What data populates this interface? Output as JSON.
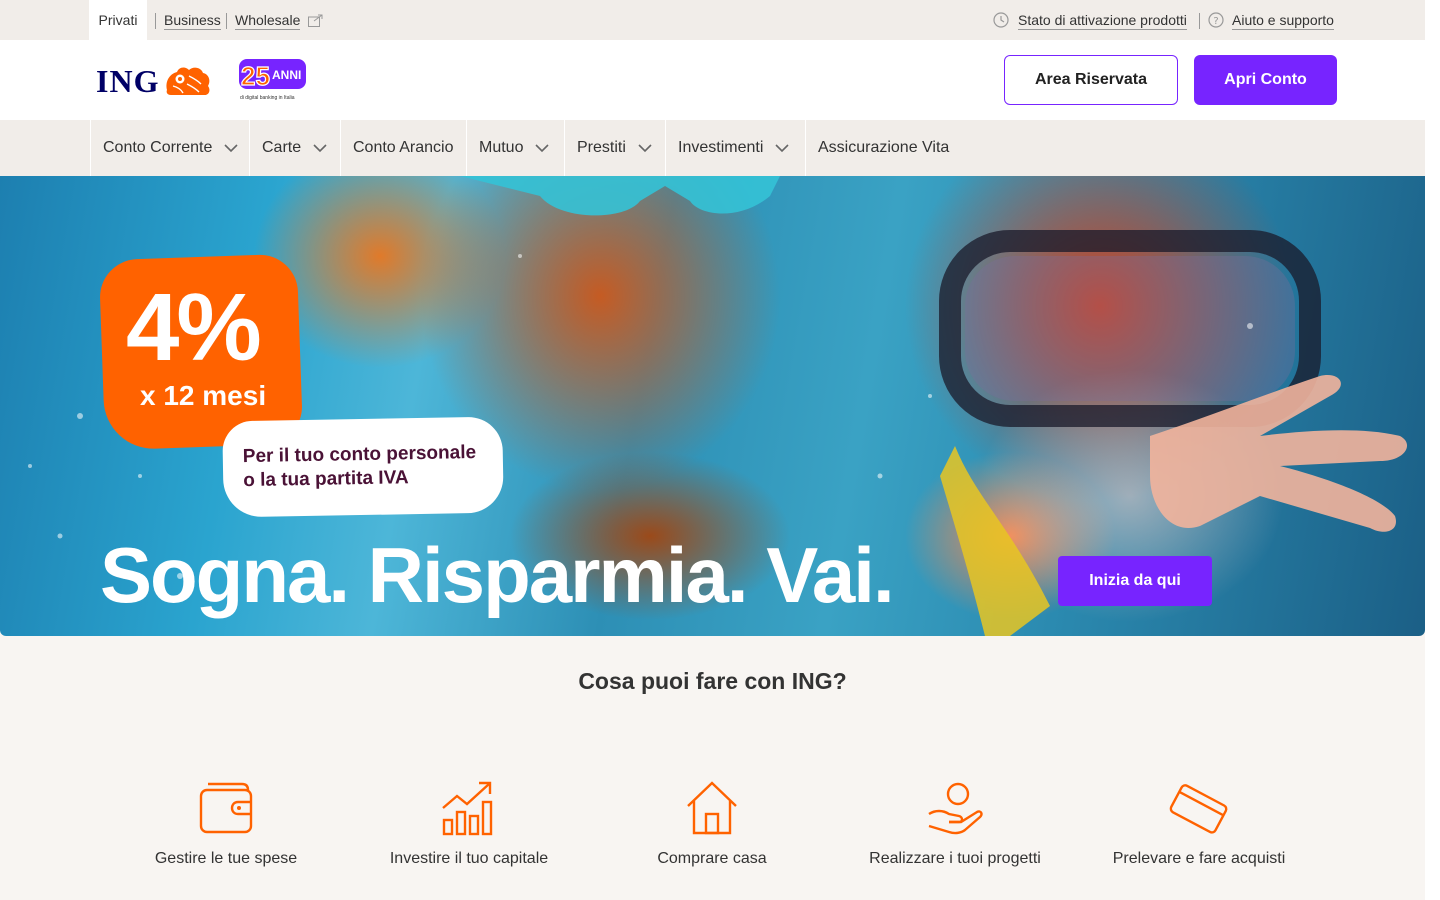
{
  "utility": {
    "tabs": [
      "Privati",
      "Business",
      "Wholesale"
    ],
    "right_links": [
      "Stato di attivazione prodotti",
      "Aiuto e supporto"
    ]
  },
  "header": {
    "logo": "ING",
    "anniversary": {
      "number": "25",
      "word": "ANNI",
      "tagline": "di digital banking in Italia"
    },
    "area_riservata": "Area Riservata",
    "apri_conto": "Apri Conto"
  },
  "nav": {
    "items": [
      {
        "label": "Conto Corrente",
        "has_dropdown": true
      },
      {
        "label": "Carte",
        "has_dropdown": true
      },
      {
        "label": "Conto Arancio",
        "has_dropdown": false
      },
      {
        "label": "Mutuo",
        "has_dropdown": true
      },
      {
        "label": "Prestiti",
        "has_dropdown": true
      },
      {
        "label": "Investimenti",
        "has_dropdown": true
      },
      {
        "label": "Assicurazione Vita",
        "has_dropdown": false
      }
    ]
  },
  "hero": {
    "rate": "4%",
    "period": "x 12 mesi",
    "bubble_line1": "Per il tuo conto personale",
    "bubble_line2": "o la tua partita IVA",
    "headline": "Sogna. Risparmia. Vai.",
    "cta": "Inizia da qui"
  },
  "section": {
    "title": "Cosa puoi fare con ING?",
    "features": [
      {
        "label": "Gestire le tue spese",
        "icon": "wallet-icon"
      },
      {
        "label": "Investire il tuo capitale",
        "icon": "growth-chart-icon"
      },
      {
        "label": "Comprare casa",
        "icon": "house-icon"
      },
      {
        "label": "Realizzare i tuoi progetti",
        "icon": "hand-coin-icon"
      },
      {
        "label": "Prelevare e fare acquisti",
        "icon": "card-icon"
      }
    ]
  },
  "colors": {
    "ing_orange": "#ff6200",
    "primary_purple": "#7724ff",
    "ing_blue": "#000066",
    "background": "#f8f5f2"
  }
}
